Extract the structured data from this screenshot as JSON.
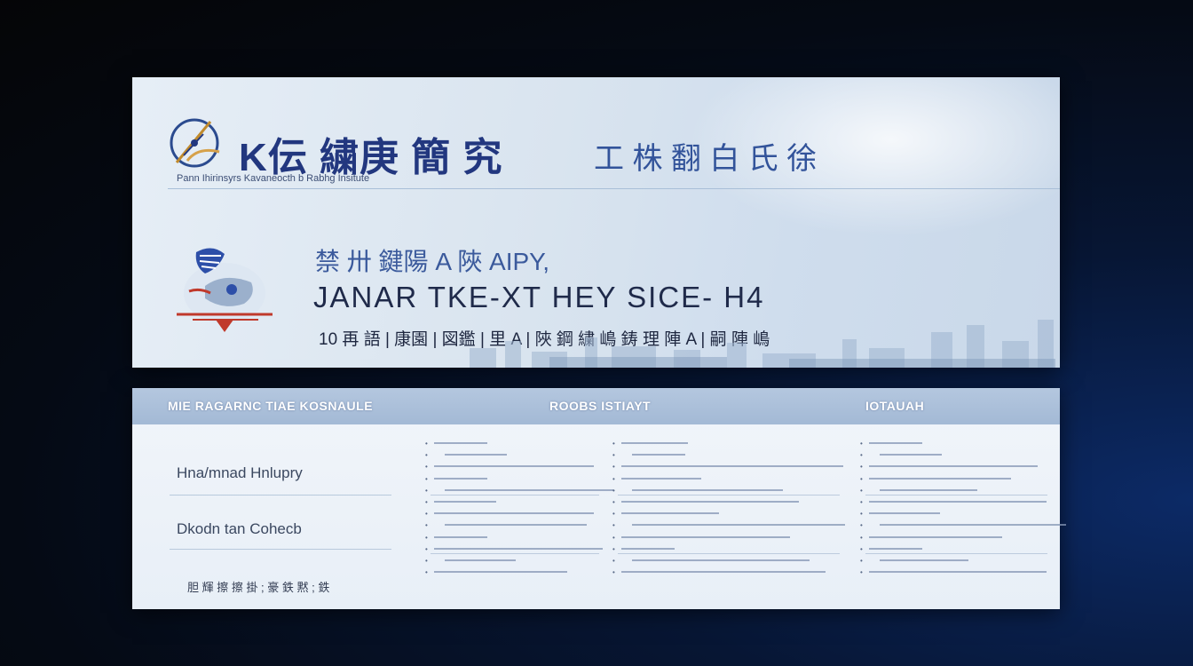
{
  "banner": {
    "header_title": "K伝 繍庚 簡 究",
    "header_suffix": "工 株 翻 白 氏 徐",
    "header_subtitle": "Pann Ihirinsyrs Kavaneocth b Rabhg Insitute",
    "line1": "禁 卅 鍵陽 A 陜 AIPY,",
    "line2": "JANAR  TKE-XT HEY SICE-  H4",
    "line3": "10 再 語 | 康園 | 図鑑 | 里 A | 陜 鋼 繍 嶋 鋳 理 陣 A | 嗣 陣 嶋"
  },
  "table": {
    "headers": [
      "MIE RAGARNC TIAE   KOSNAULE",
      "ROOBS  ISTIAYT",
      "IOTAUAH"
    ],
    "rows": [
      "Hna/mnad  Hnlupry",
      "Dkodn  tan  Cohecb"
    ],
    "footer": "胆 輝 擦 擦 掛 ;  豪 鉄 黙 ; 鉄"
  },
  "colors": {
    "navy": "#22377f",
    "accent_blue": "#3b5a9c",
    "header_band": "#a3b9d5",
    "emblem_red": "#c0392b"
  },
  "icons": [
    "compass-logo-icon",
    "fish-emblem-icon",
    "city-skyline-icon"
  ]
}
